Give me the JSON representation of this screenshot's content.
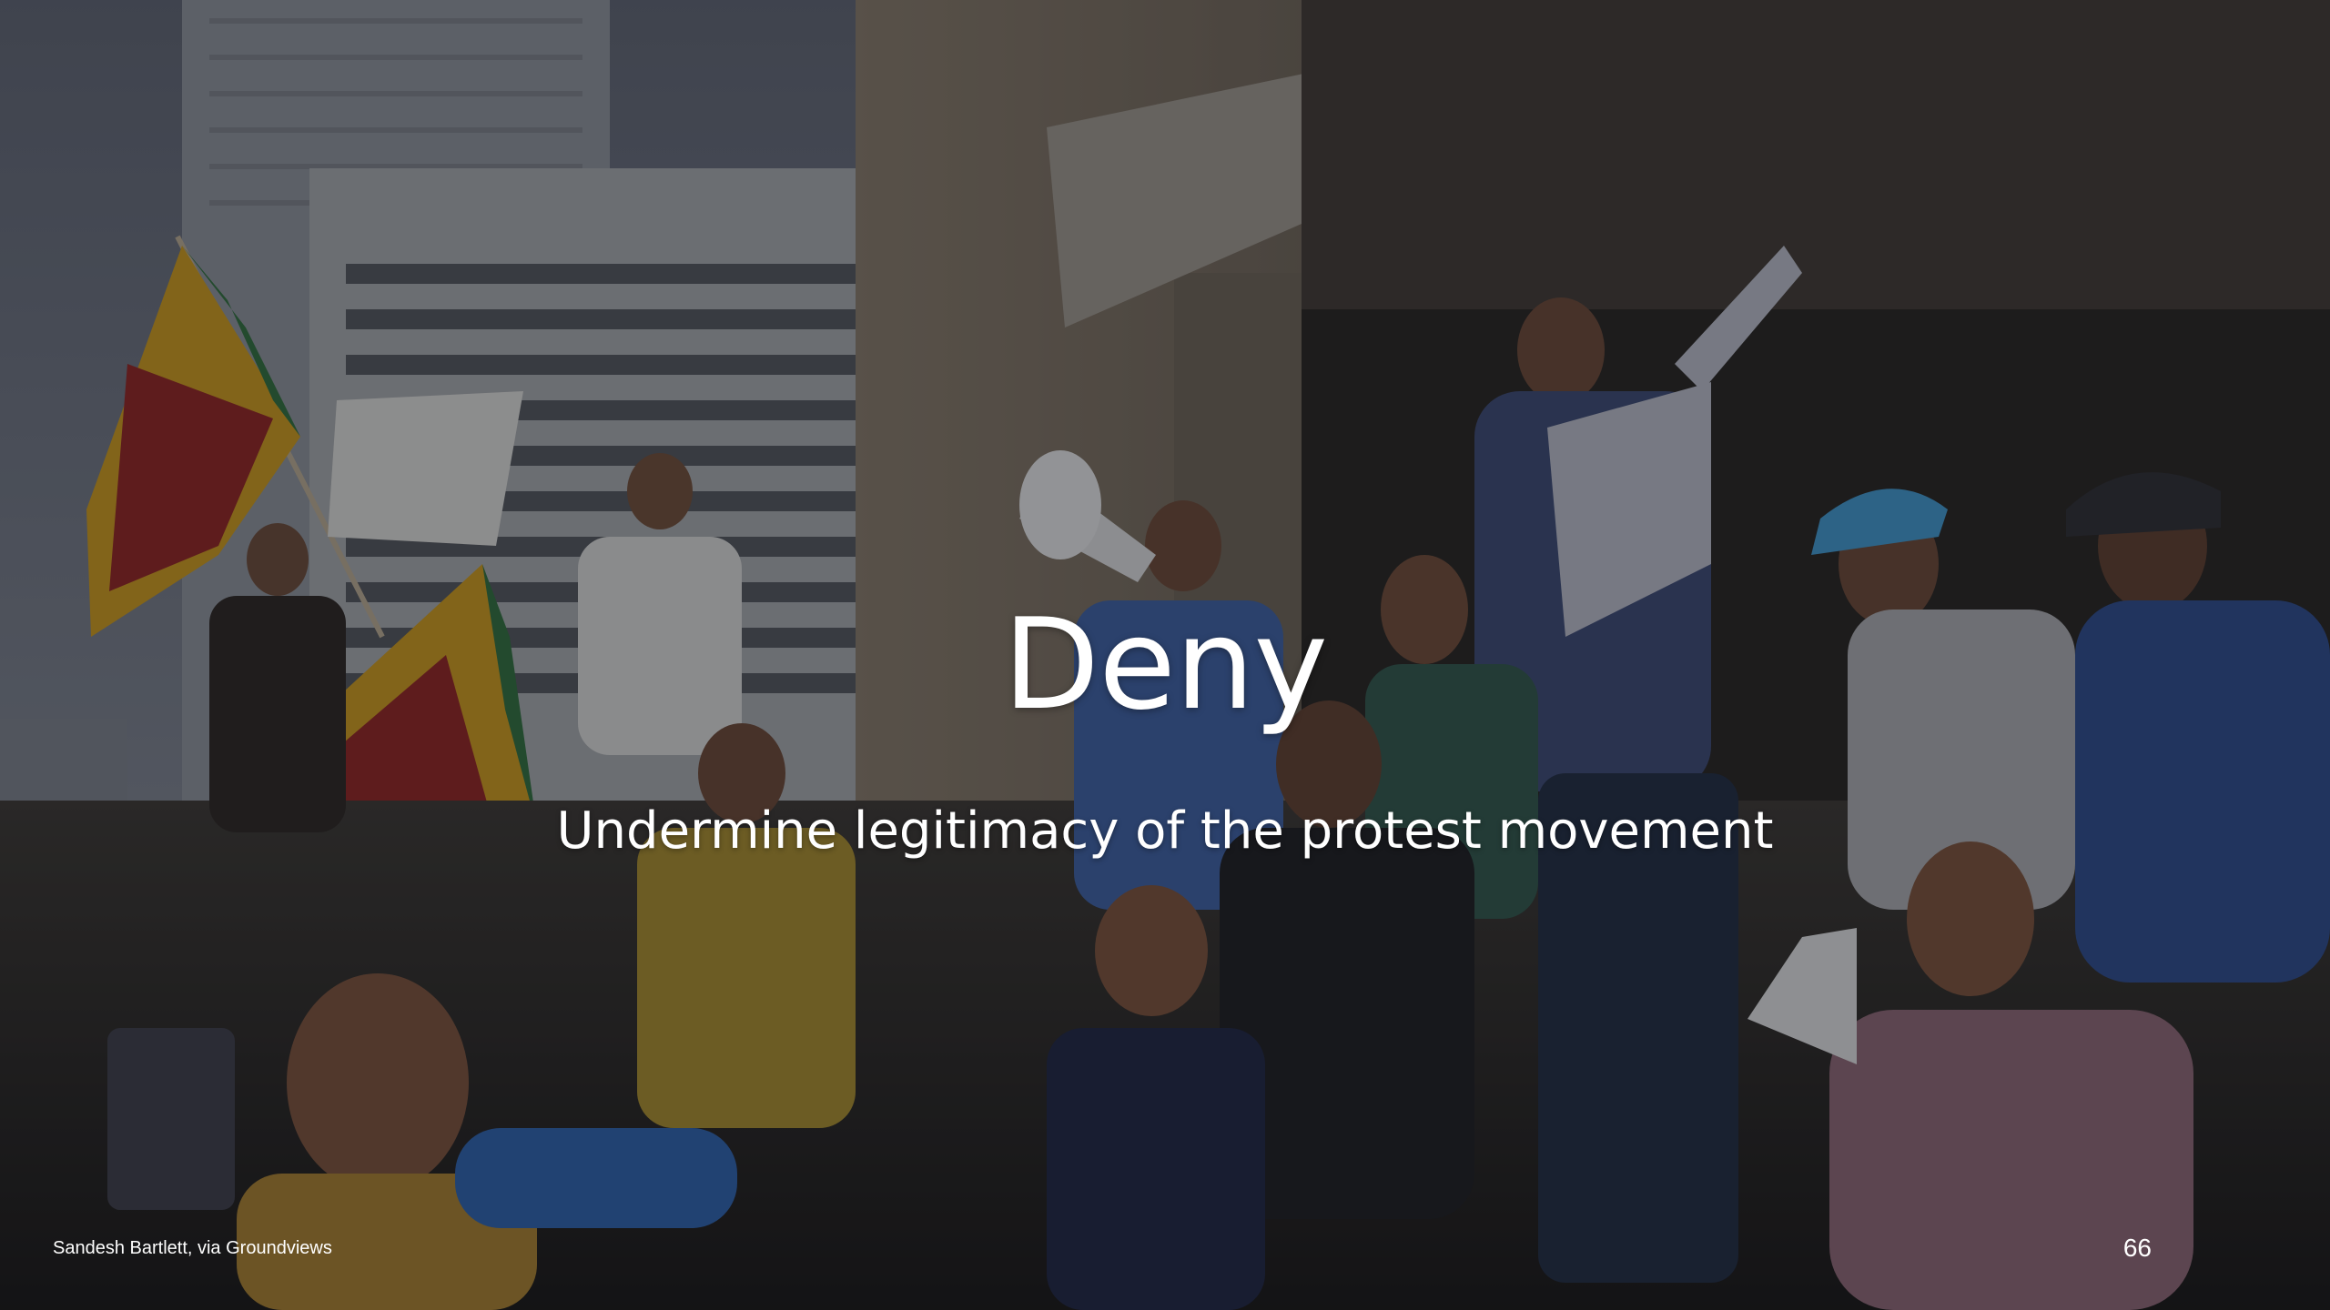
{
  "slide": {
    "title": "Deny",
    "subtitle": "Undermine legitimacy of the protest movement",
    "photo_credit": "Sandesh Bartlett, via Groundviews",
    "page_number": "66"
  },
  "photo": {
    "description_icon": "protest-crowd-photo",
    "colors": {
      "sky": "#6f7482",
      "building": "#8a8d92",
      "facade": "#5e5347",
      "flag_gold": "#c8961a",
      "flag_red": "#8f2320",
      "flag_green": "#2f6d3b",
      "shirt_blue": "#2e4a7a",
      "overlay": "#0f1219"
    }
  }
}
